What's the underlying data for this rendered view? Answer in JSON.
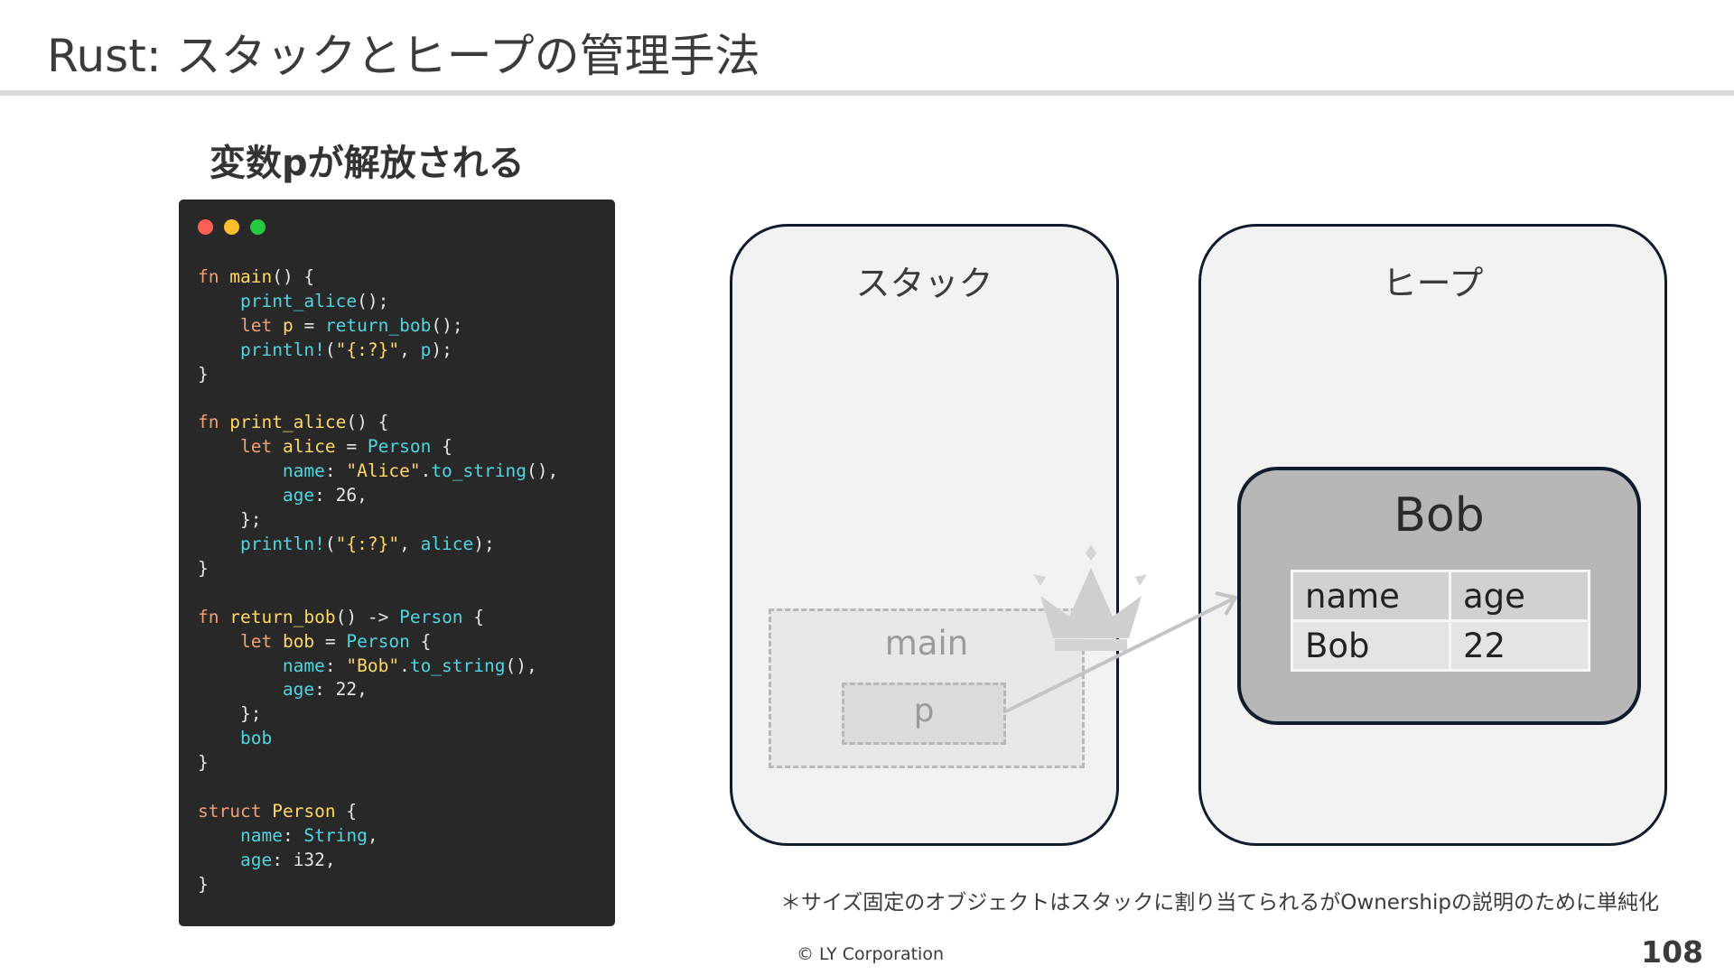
{
  "slide": {
    "title": "Rust: スタックとヒープの管理手法",
    "subtitle": "変数pが解放される",
    "footnote": "＊サイズ固定のオブジェクトはスタックに割り当てられるがOwnershipの説明のために単純化",
    "copyright": "© LY Corporation",
    "page_number": "108"
  },
  "code_window": {
    "language": "Rust",
    "colors": {
      "background": "#282828",
      "keyword": "#f0a077",
      "function": "#ffd866",
      "type": "#4fd6e0",
      "string": "#ffd866"
    },
    "tokens": {
      "fn": "fn",
      "let": "let",
      "struct": "struct",
      "arrow": "->",
      "main": "main",
      "print_alice": "print_alice",
      "return_bob": "return_bob",
      "println": "println!",
      "fmt": "\"{:?}\"",
      "p": "p",
      "alice": "alice",
      "bob": "bob",
      "Person": "Person",
      "name": "name",
      "age": "age",
      "alice_str": "\"Alice\"",
      "bob_str": "\"Bob\"",
      "to_string": "to_string",
      "n26": "26",
      "n22": "22",
      "String": "String",
      "i32": "i32"
    }
  },
  "diagram": {
    "stack_label": "スタック",
    "heap_label": "ヒープ",
    "frame_label": "main",
    "variable_label": "p",
    "object_label": "Bob",
    "fields": {
      "header": [
        "name",
        "age"
      ],
      "values": [
        "Bob",
        "22"
      ]
    },
    "owner_icon": "crown-icon",
    "colors": {
      "panel": "#f2f2f2",
      "panel_border": "#121a2e",
      "object": "#b7b7b7",
      "faded": "#b8b8b8"
    }
  }
}
